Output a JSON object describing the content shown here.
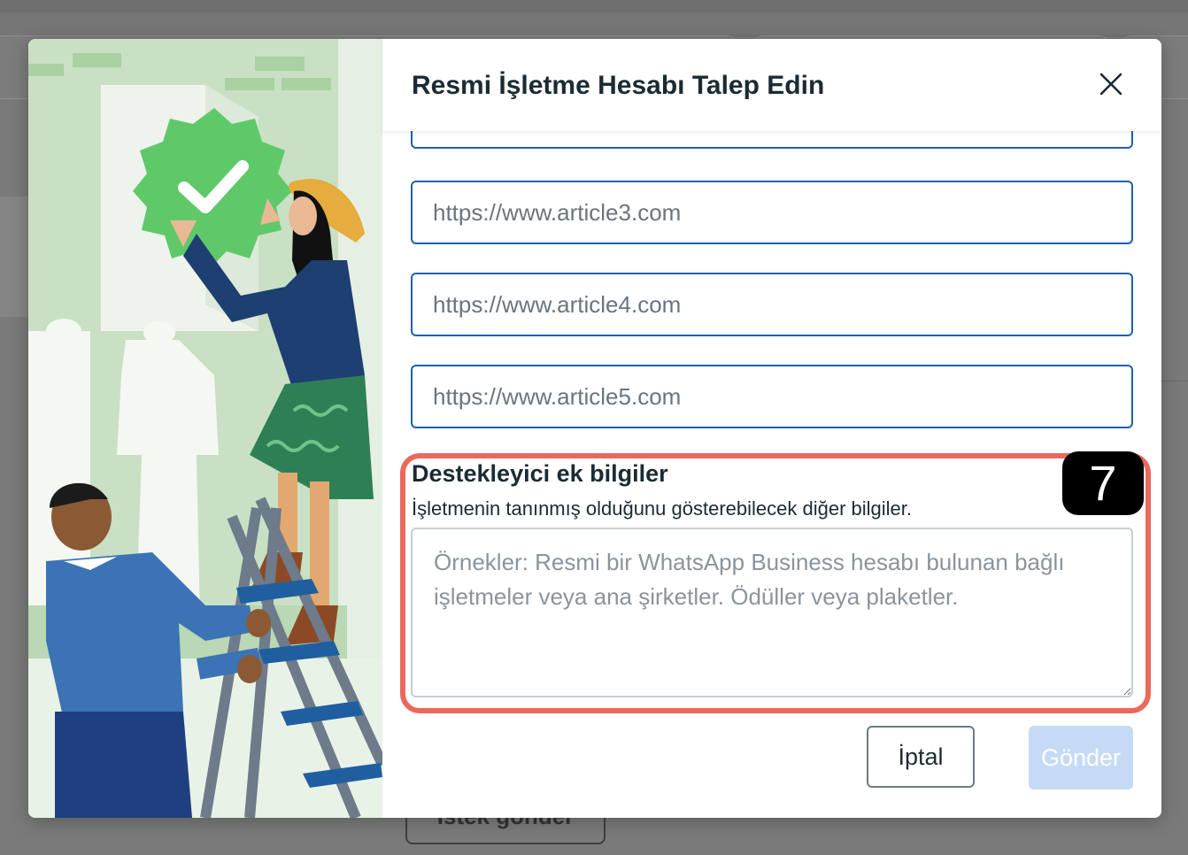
{
  "modal": {
    "title": "Resmi İşletme Hesabı Talep Edin",
    "close_label": "×"
  },
  "article_urls": [
    {
      "placeholder": "https://www.article3.com"
    },
    {
      "placeholder": "https://www.article4.com"
    },
    {
      "placeholder": "https://www.article5.com"
    }
  ],
  "supporting_info": {
    "label": "Destekleyici ek bilgiler",
    "help": "İşletmenin tanınmış olduğunu gösterebilecek diğer bilgiler.",
    "placeholder": "Örnekler: Resmi bir WhatsApp Business hesabı bulunan bağlı işletmeler veya ana şirketler. Ödüller veya plaketler."
  },
  "step_badge": "7",
  "actions": {
    "cancel": "İptal",
    "submit": "Gönder"
  },
  "background": {
    "bottom_button": "Istek gönder"
  },
  "colors": {
    "accent": "#1f5fad",
    "highlight": "#e96a5c",
    "submit_disabled": "#c5dbf5"
  }
}
